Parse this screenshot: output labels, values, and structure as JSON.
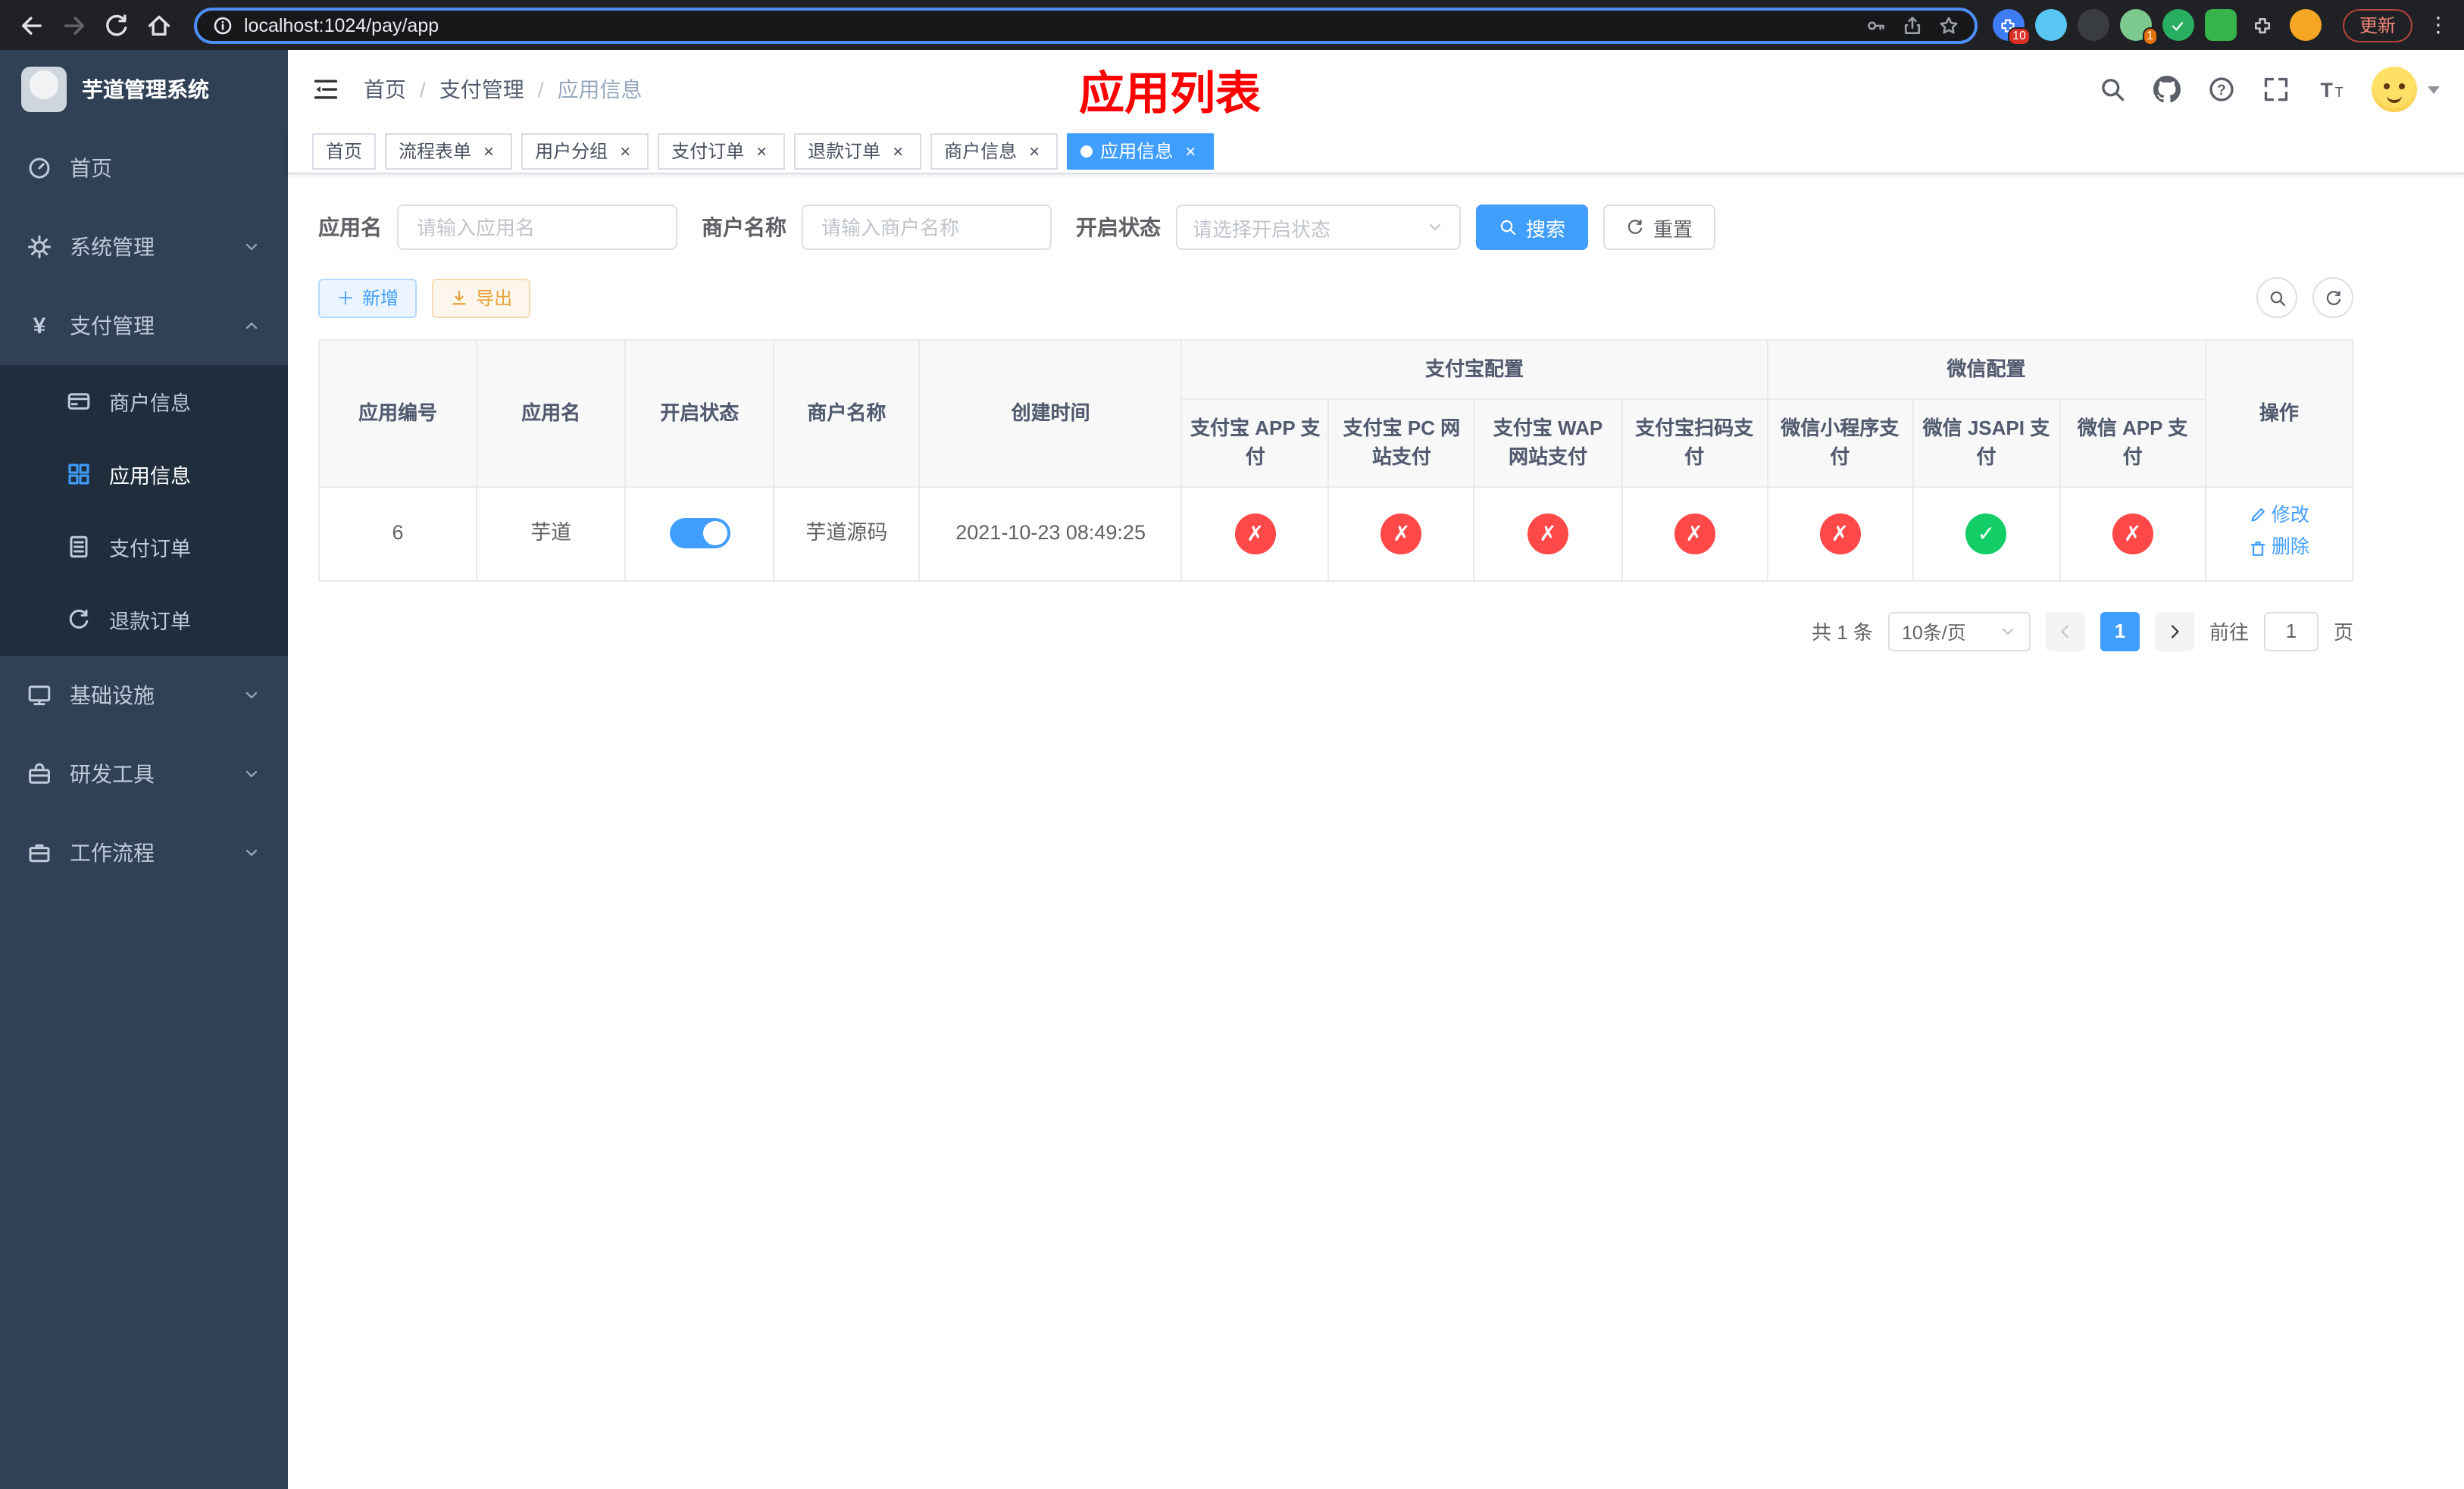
{
  "colors": {
    "accent": "#409EFF",
    "danger": "#ff4949",
    "success": "#13ce66",
    "title_red": "#ff0000",
    "sidebar_bg": "#304156",
    "submenu_bg": "#1f2d3d"
  },
  "browser": {
    "url": "localhost:1024/pay/app",
    "update_button": "更新",
    "extensions": [
      {
        "name": "puzzle-icon",
        "badge": "10"
      },
      {
        "name": "gem-icon"
      },
      {
        "name": "dark-circle-icon"
      },
      {
        "name": "avatar-icon",
        "badge": "1"
      },
      {
        "name": "green-check-icon"
      },
      {
        "name": "green-square-icon"
      },
      {
        "name": "pin-icon"
      },
      {
        "name": "emoji-icon"
      }
    ]
  },
  "sidebar": {
    "title": "芋道管理系统",
    "items": [
      {
        "label": "首页",
        "icon": "dashboard-icon"
      },
      {
        "label": "系统管理",
        "icon": "gear-icon"
      },
      {
        "label": "支付管理",
        "icon": "yen-icon",
        "expanded": true,
        "children": [
          {
            "label": "商户信息",
            "icon": "card-icon",
            "active": false
          },
          {
            "label": "应用信息",
            "icon": "grid-icon",
            "active": true
          },
          {
            "label": "支付订单",
            "icon": "document-icon",
            "active": false
          },
          {
            "label": "退款订单",
            "icon": "refund-icon",
            "active": false
          }
        ]
      },
      {
        "label": "基础设施",
        "icon": "monitor-icon"
      },
      {
        "label": "研发工具",
        "icon": "toolbox-icon"
      },
      {
        "label": "工作流程",
        "icon": "briefcase-icon"
      }
    ]
  },
  "header": {
    "breadcrumb": [
      "首页",
      "支付管理",
      "应用信息"
    ],
    "page_title": "应用列表",
    "icons": [
      "search-icon",
      "github-icon",
      "help-icon",
      "fullscreen-icon",
      "font-size-icon",
      "avatar"
    ]
  },
  "tabs": [
    {
      "label": "首页",
      "closable": false,
      "active": false
    },
    {
      "label": "流程表单",
      "closable": true,
      "active": false
    },
    {
      "label": "用户分组",
      "closable": true,
      "active": false
    },
    {
      "label": "支付订单",
      "closable": true,
      "active": false
    },
    {
      "label": "退款订单",
      "closable": true,
      "active": false
    },
    {
      "label": "商户信息",
      "closable": true,
      "active": false
    },
    {
      "label": "应用信息",
      "closable": true,
      "active": true
    }
  ],
  "filters": {
    "app_name_label": "应用名",
    "app_name_placeholder": "请输入应用名",
    "merchant_label": "商户名称",
    "merchant_placeholder": "请输入商户名称",
    "status_label": "开启状态",
    "status_placeholder": "请选择开启状态",
    "search_button": "搜索",
    "reset_button": "重置"
  },
  "toolbar": {
    "add_button": "新增",
    "export_button": "导出"
  },
  "table": {
    "columns": [
      "应用编号",
      "应用名",
      "开启状态",
      "商户名称",
      "创建时间"
    ],
    "group_alipay": "支付宝配置",
    "alipay_columns": [
      "支付宝 APP 支付",
      "支付宝 PC 网站支付",
      "支付宝 WAP 网站支付",
      "支付宝扫码支付"
    ],
    "group_wechat": "微信配置",
    "wechat_columns": [
      "微信小程序支付",
      "微信 JSAPI 支付",
      "微信 APP 支付"
    ],
    "ops_column": "操作",
    "rows": [
      {
        "id": "6",
        "name": "芋道",
        "enabled": true,
        "merchant": "芋道源码",
        "created": "2021-10-23 08:49:25",
        "alipay": [
          false,
          false,
          false,
          false
        ],
        "wechat": [
          false,
          true,
          false
        ],
        "edit": "修改",
        "delete": "删除"
      }
    ]
  },
  "pagination": {
    "total": "共 1 条",
    "page_size": "10条/页",
    "current_page": "1",
    "goto_label": "前往",
    "goto_value": "1",
    "goto_suffix": "页"
  }
}
